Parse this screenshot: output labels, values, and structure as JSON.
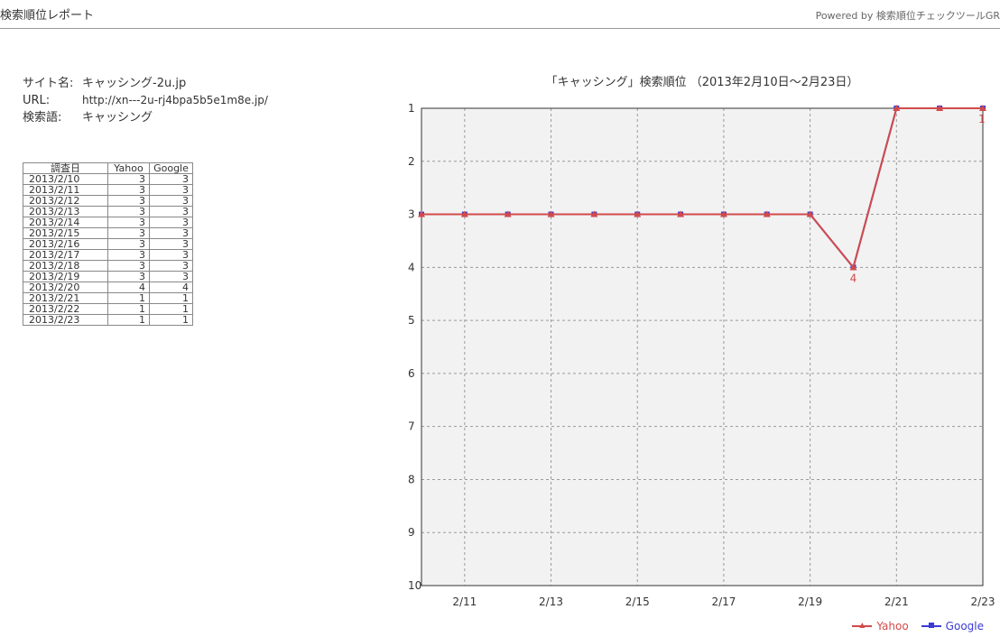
{
  "header": {
    "title": "検索順位レポート",
    "powered_by": "Powered by 検索順位チェックツールGR"
  },
  "info": {
    "site_label": "サイト名:",
    "site_value": "キャッシング-2u.jp",
    "url_label": "URL:",
    "url_value": "http://xn---2u-rj4bpa5b5e1m8e.jp/",
    "keyword_label": "検索語:",
    "keyword_value": "キャッシング"
  },
  "table": {
    "headers": [
      "調査日",
      "Yahoo",
      "Google"
    ],
    "rows": [
      [
        "2013/2/10",
        "3",
        "3"
      ],
      [
        "2013/2/11",
        "3",
        "3"
      ],
      [
        "2013/2/12",
        "3",
        "3"
      ],
      [
        "2013/2/13",
        "3",
        "3"
      ],
      [
        "2013/2/14",
        "3",
        "3"
      ],
      [
        "2013/2/15",
        "3",
        "3"
      ],
      [
        "2013/2/16",
        "3",
        "3"
      ],
      [
        "2013/2/17",
        "3",
        "3"
      ],
      [
        "2013/2/18",
        "3",
        "3"
      ],
      [
        "2013/2/19",
        "3",
        "3"
      ],
      [
        "2013/2/20",
        "4",
        "4"
      ],
      [
        "2013/2/21",
        "1",
        "1"
      ],
      [
        "2013/2/22",
        "1",
        "1"
      ],
      [
        "2013/2/23",
        "1",
        "1"
      ]
    ]
  },
  "chart_data": {
    "type": "line",
    "title": "「キャッシング」検索順位 （2013年2月10日～2月23日）",
    "x": [
      "2/10",
      "2/11",
      "2/12",
      "2/13",
      "2/14",
      "2/15",
      "2/16",
      "2/17",
      "2/18",
      "2/19",
      "2/20",
      "2/21",
      "2/22",
      "2/23"
    ],
    "x_tick_labels": [
      "2/11",
      "2/13",
      "2/15",
      "2/17",
      "2/19",
      "2/21",
      "2/23"
    ],
    "y_ticks": [
      1,
      2,
      3,
      4,
      5,
      6,
      7,
      8,
      9,
      10
    ],
    "ylim": [
      1,
      10
    ],
    "y_inverted": true,
    "grid": true,
    "legend": "bottom-right",
    "series": [
      {
        "name": "Yahoo",
        "color": "#d24a4a",
        "marker": "triangle",
        "values": [
          3,
          3,
          3,
          3,
          3,
          3,
          3,
          3,
          3,
          3,
          4,
          1,
          1,
          1
        ]
      },
      {
        "name": "Google",
        "color": "#3b3bd6",
        "marker": "square",
        "values": [
          3,
          3,
          3,
          3,
          3,
          3,
          3,
          3,
          3,
          3,
          4,
          1,
          1,
          1
        ]
      }
    ],
    "annotations": [
      {
        "x": "2/20",
        "y": 4,
        "text": "4"
      },
      {
        "x": "2/23",
        "y": 1,
        "text": "1"
      }
    ],
    "plot_background": "#f2f2f2"
  }
}
